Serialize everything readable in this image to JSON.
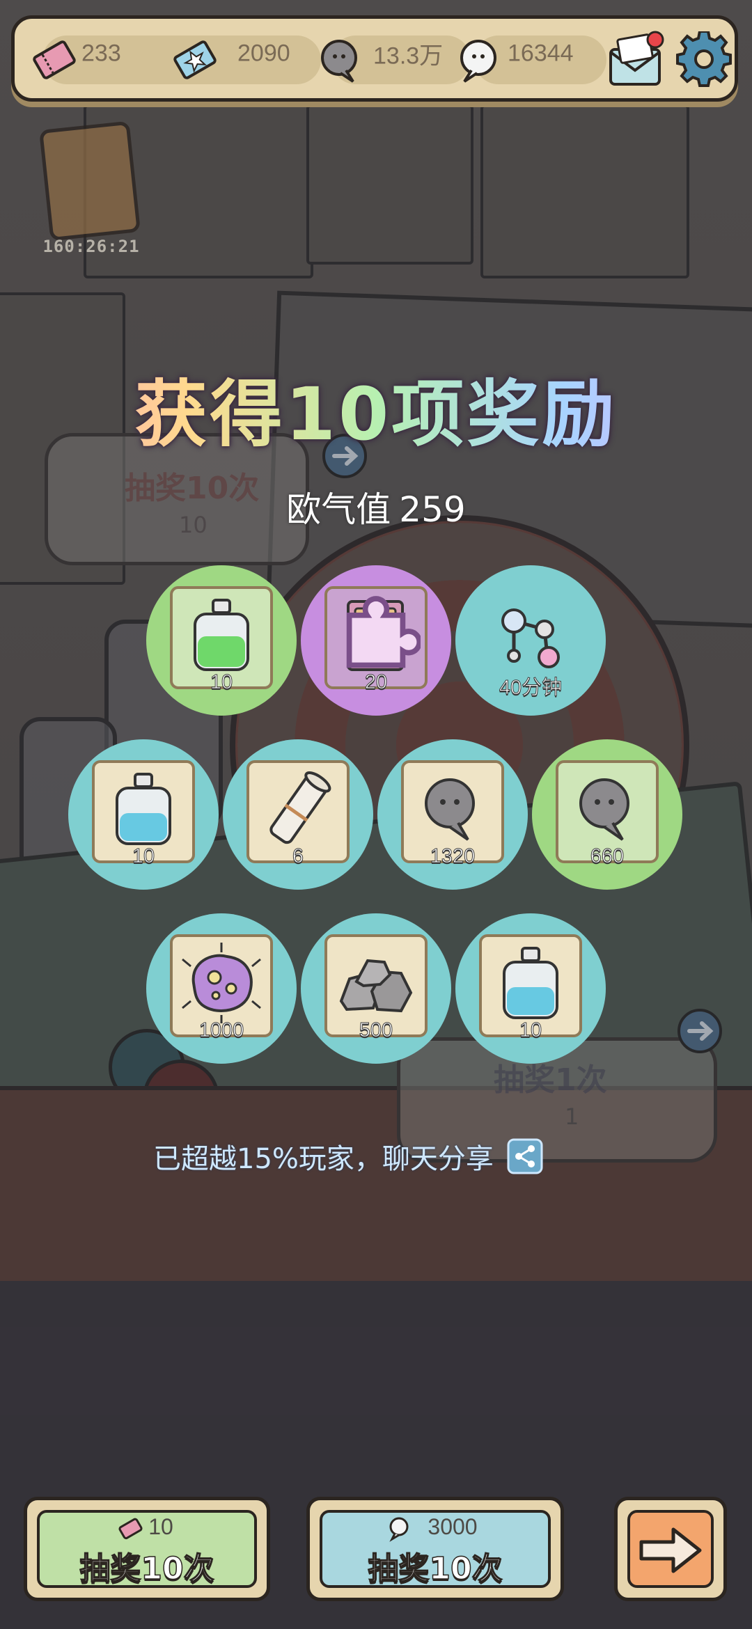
{
  "hud": {
    "ticket_count": "233",
    "star_ticket_count": "2090",
    "gray_bubble_count": "13.3万",
    "white_bubble_count": "16344"
  },
  "card_timer": "160:26:21",
  "background_panels": {
    "draw10_label": "抽奖10次",
    "draw10_cost": "10",
    "draw1_label": "抽奖1次",
    "draw1_cost": "1"
  },
  "popup": {
    "title": "获得10项奖励",
    "luck_label": "欧气值",
    "luck_value": "259",
    "share_text": "已超越15%玩家，聊天分享"
  },
  "rewards": [
    {
      "name": "green-potion",
      "qty": "10",
      "ring": "green"
    },
    {
      "name": "spell-book",
      "qty": "20",
      "ring": "purple"
    },
    {
      "name": "molecule-boost",
      "qty": "40分钟",
      "ring": "teal"
    },
    {
      "name": "blue-potion",
      "qty": "10",
      "ring": "teal"
    },
    {
      "name": "scroll",
      "qty": "6",
      "ring": "teal"
    },
    {
      "name": "gray-bubble",
      "qty": "1320",
      "ring": "teal"
    },
    {
      "name": "gray-bubble-green",
      "qty": "660",
      "ring": "green"
    },
    {
      "name": "germ",
      "qty": "1000",
      "ring": "teal"
    },
    {
      "name": "stones",
      "qty": "500",
      "ring": "teal"
    },
    {
      "name": "blue-potion-2",
      "qty": "10",
      "ring": "teal"
    }
  ],
  "buttons": {
    "ticket_draw": {
      "cost": "10",
      "label": "抽奖10次"
    },
    "bubble_draw": {
      "cost": "3000",
      "label": "抽奖10次"
    }
  },
  "colors": {
    "hud_bg": "#e6d5ae",
    "ring_teal": "#7fcfd0",
    "ring_green": "#9fd883",
    "ring_purple": "#c78ee0",
    "btn_green": "#bfe0a6",
    "btn_blue": "#a9d7df",
    "btn_orange": "#f3a56d"
  }
}
